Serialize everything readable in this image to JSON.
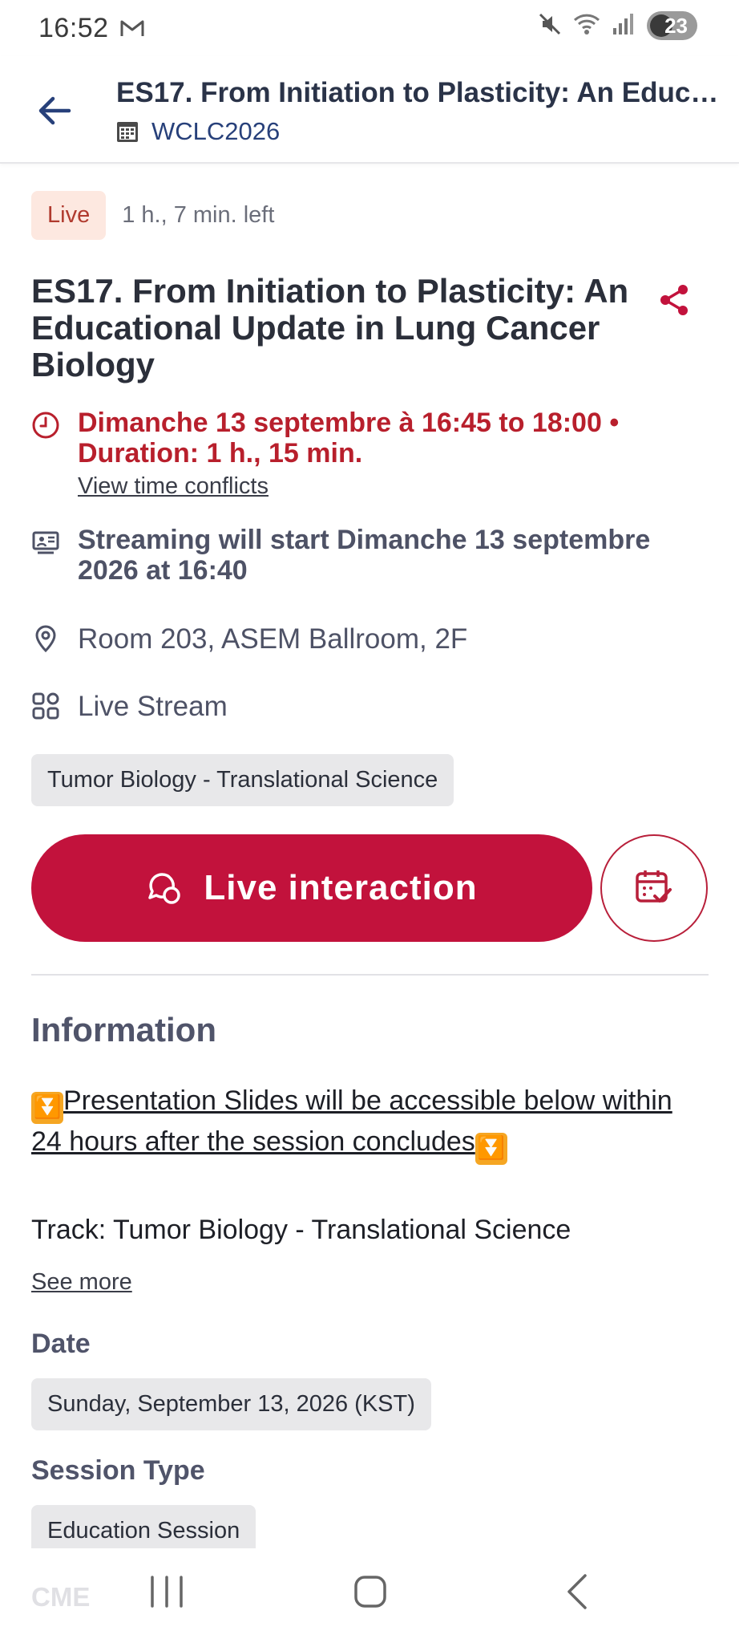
{
  "status_bar": {
    "time": "16:52",
    "battery": "23"
  },
  "header": {
    "title": "ES17. From Initiation to Plasticity: An Educat...",
    "event_name": "WCLC2026"
  },
  "session": {
    "live_badge": "Live",
    "time_left": "1 h., 7 min. left",
    "title": "ES17. From Initiation to Plasticity: An Educational Update in Lung Cancer Biology",
    "datetime": "Dimanche 13 septembre à 16:45 to 18:00 • Duration: 1 h., 15 min.",
    "conflicts_link": "View time conflicts",
    "streaming": "Streaming will start Dimanche 13 septembre 2026 at 16:40",
    "room": "Room 203, ASEM Ballroom, 2F",
    "stream_type": "Live Stream",
    "tag": "Tumor Biology - Translational Science"
  },
  "actions": {
    "live_interaction": "Live interaction"
  },
  "information": {
    "heading": "Information",
    "slides_note": "Presentation Slides will be accessible below within 24 hours after the session concludes",
    "emoji": "⏬",
    "track": "Track: Tumor Biology - Translational Science",
    "see_more": "See more",
    "date_label": "Date",
    "date_value": "Sunday, September 13, 2026 (KST)",
    "session_type_label": "Session Type",
    "session_type_value": "Education Session",
    "cme_label": "CME"
  },
  "colors": {
    "accent": "#c2123c",
    "date_red": "#b81f2c",
    "live_badge_bg": "#fde8e0",
    "link_blue": "#27407a"
  },
  "icons": {
    "back": "arrow-left-icon",
    "event": "calendar-grid-icon",
    "share": "share-icon",
    "clock": "clock-icon",
    "streaming": "presentation-icon",
    "location": "location-pin-icon",
    "stream_type": "grid-icon",
    "chat": "chat-bubble-icon",
    "calendar_check": "calendar-check-icon"
  }
}
